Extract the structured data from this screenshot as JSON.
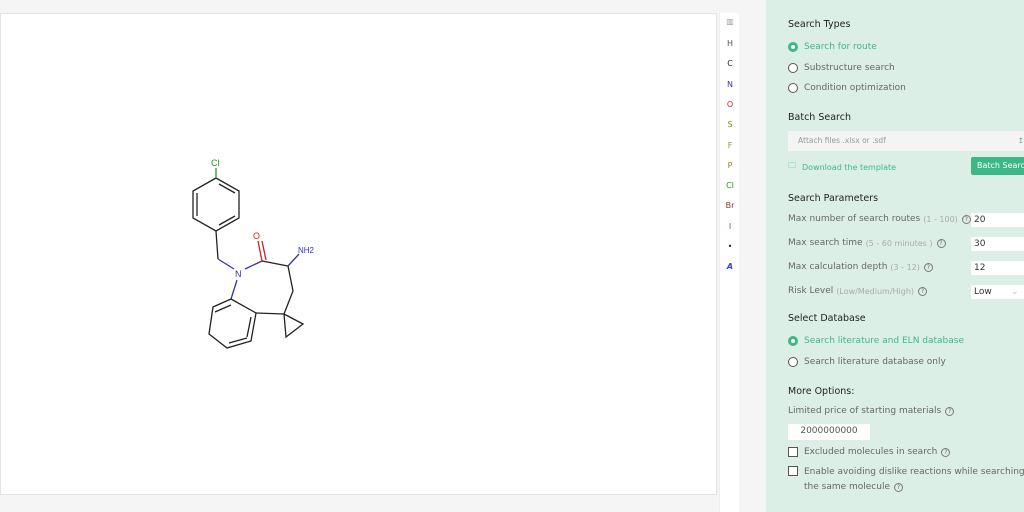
{
  "molecule": {
    "atoms": {
      "cl": "Cl",
      "n": "N",
      "o": "O",
      "nh2": "NH2"
    }
  },
  "toolbar": {
    "elements": [
      {
        "label": "H",
        "color": "#555555"
      },
      {
        "label": "C",
        "color": "#222222"
      },
      {
        "label": "N",
        "color": "#3333aa"
      },
      {
        "label": "O",
        "color": "#cc2222"
      },
      {
        "label": "S",
        "color": "#888822"
      },
      {
        "label": "F",
        "color": "#aa8833"
      },
      {
        "label": "P",
        "color": "#aa7722"
      },
      {
        "label": "Cl",
        "color": "#229922"
      },
      {
        "label": "Br",
        "color": "#883333"
      },
      {
        "label": "I",
        "color": "#8844aa"
      },
      {
        "label": "•",
        "color": "#222222"
      },
      {
        "label": "A",
        "color": "#3344cc"
      }
    ]
  },
  "panel": {
    "search_types": {
      "title": "Search Types",
      "options": [
        "Search for route",
        "Substructure search",
        "Condition optimization"
      ],
      "selected": 0
    },
    "batch": {
      "title": "Batch Search",
      "placeholder": "Attach files .xlsx or .sdf",
      "download": "Download the template",
      "button": "Batch Search"
    },
    "params": {
      "title": "Search Parameters",
      "items": [
        {
          "label": "Max number of search routes",
          "hint": "(1 - 100)",
          "value": "20"
        },
        {
          "label": "Max search time",
          "hint": "(5 - 60 minutes )",
          "value": "30"
        },
        {
          "label": "Max calculation depth",
          "hint": "(3 - 12)",
          "value": "12"
        },
        {
          "label": "Risk Level",
          "hint": "(Low/Medium/High)",
          "value": "Low"
        }
      ]
    },
    "database": {
      "title": "Select Database",
      "options": [
        "Search literature and ELN database",
        "Search literature database only"
      ],
      "selected": 0
    },
    "more": {
      "title": "More Options:",
      "price_label": "Limited price of starting materials",
      "price_value": "2000000000",
      "excluded": "Excluded molecules in search",
      "avoid": "Enable avoiding dislike reactions while searching",
      "avoid2": "the same molecule"
    },
    "accent": "#3cb887"
  }
}
